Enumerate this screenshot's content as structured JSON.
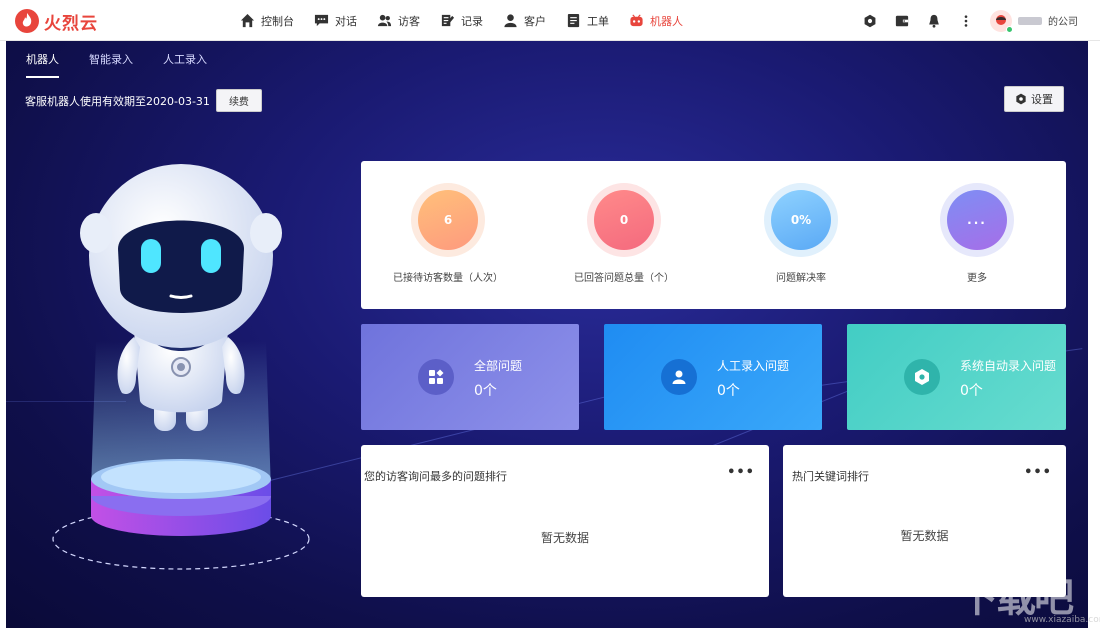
{
  "logo": {
    "text": "火烈云"
  },
  "nav": [
    {
      "label": "控制台",
      "icon": "home-icon"
    },
    {
      "label": "对话",
      "icon": "chat-icon"
    },
    {
      "label": "访客",
      "icon": "visitors-icon"
    },
    {
      "label": "记录",
      "icon": "record-icon"
    },
    {
      "label": "客户",
      "icon": "customer-icon"
    },
    {
      "label": "工单",
      "icon": "ticket-icon"
    },
    {
      "label": "机器人",
      "icon": "robot-icon",
      "active": true
    }
  ],
  "account": {
    "company_suffix": "的公司"
  },
  "subtabs": [
    {
      "label": "机器人",
      "active": true
    },
    {
      "label": "智能录入"
    },
    {
      "label": "人工录入"
    }
  ],
  "validity": {
    "text": "客服机器人使用有效期至2020-03-31",
    "renew_label": "续费"
  },
  "settings": {
    "label": "设置"
  },
  "stats": [
    {
      "value": "6",
      "label": "已接待访客数量（人次）"
    },
    {
      "value": "0",
      "label": "已回答问题总量（个）"
    },
    {
      "value": "0%",
      "label": "问题解决率"
    },
    {
      "value": "...",
      "label": "更多"
    }
  ],
  "categories": [
    {
      "title": "全部问题",
      "count": "0个"
    },
    {
      "title": "人工录入问题",
      "count": "0个"
    },
    {
      "title": "系统自动录入问题",
      "count": "0个"
    }
  ],
  "panels": [
    {
      "title": "您的访客询问最多的问题排行",
      "more": "•••",
      "empty": "暂无数据"
    },
    {
      "title": "热门关键词排行",
      "more": "•••",
      "empty": "暂无数据"
    }
  ],
  "watermark": {
    "text": "下载吧",
    "sub": "www.xiazaiba.com"
  },
  "colors": {
    "accent": "#e8453c",
    "card_all": "#7b80e0",
    "card_manual": "#2f9bf7",
    "card_auto": "#4fd3c8"
  }
}
